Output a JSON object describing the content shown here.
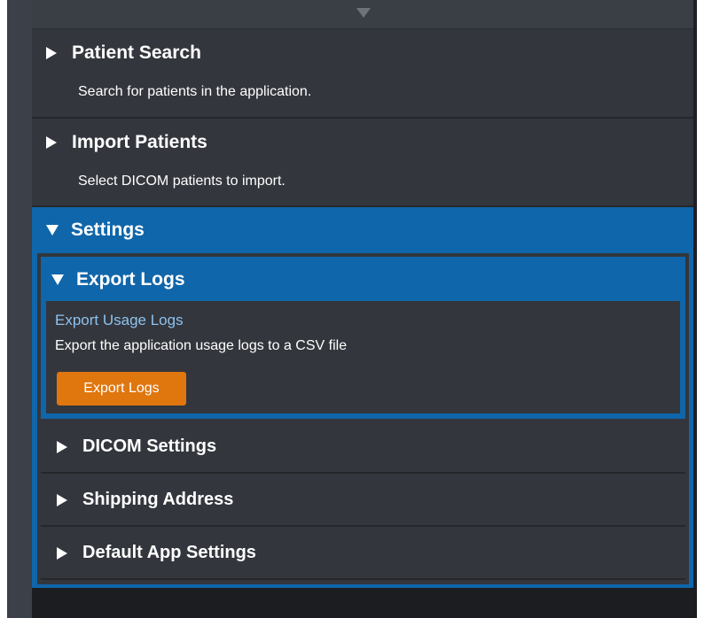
{
  "sections": {
    "patient_search": {
      "title": "Patient Search",
      "description": "Search for patients in the application."
    },
    "import_patients": {
      "title": "Import Patients",
      "description": "Select DICOM patients to import."
    },
    "settings": {
      "title": "Settings",
      "export_logs": {
        "title": "Export Logs",
        "sub_title": "Export Usage Logs",
        "description": "Export the application usage logs to a CSV file",
        "button_label": "Export Logs"
      },
      "items": [
        {
          "title": "DICOM Settings"
        },
        {
          "title": "Shipping Address"
        },
        {
          "title": "Default App Settings"
        }
      ]
    }
  },
  "colors": {
    "accent_blue": "#1066aa",
    "button_orange": "#e0760e",
    "panel_gray": "#33363c"
  }
}
